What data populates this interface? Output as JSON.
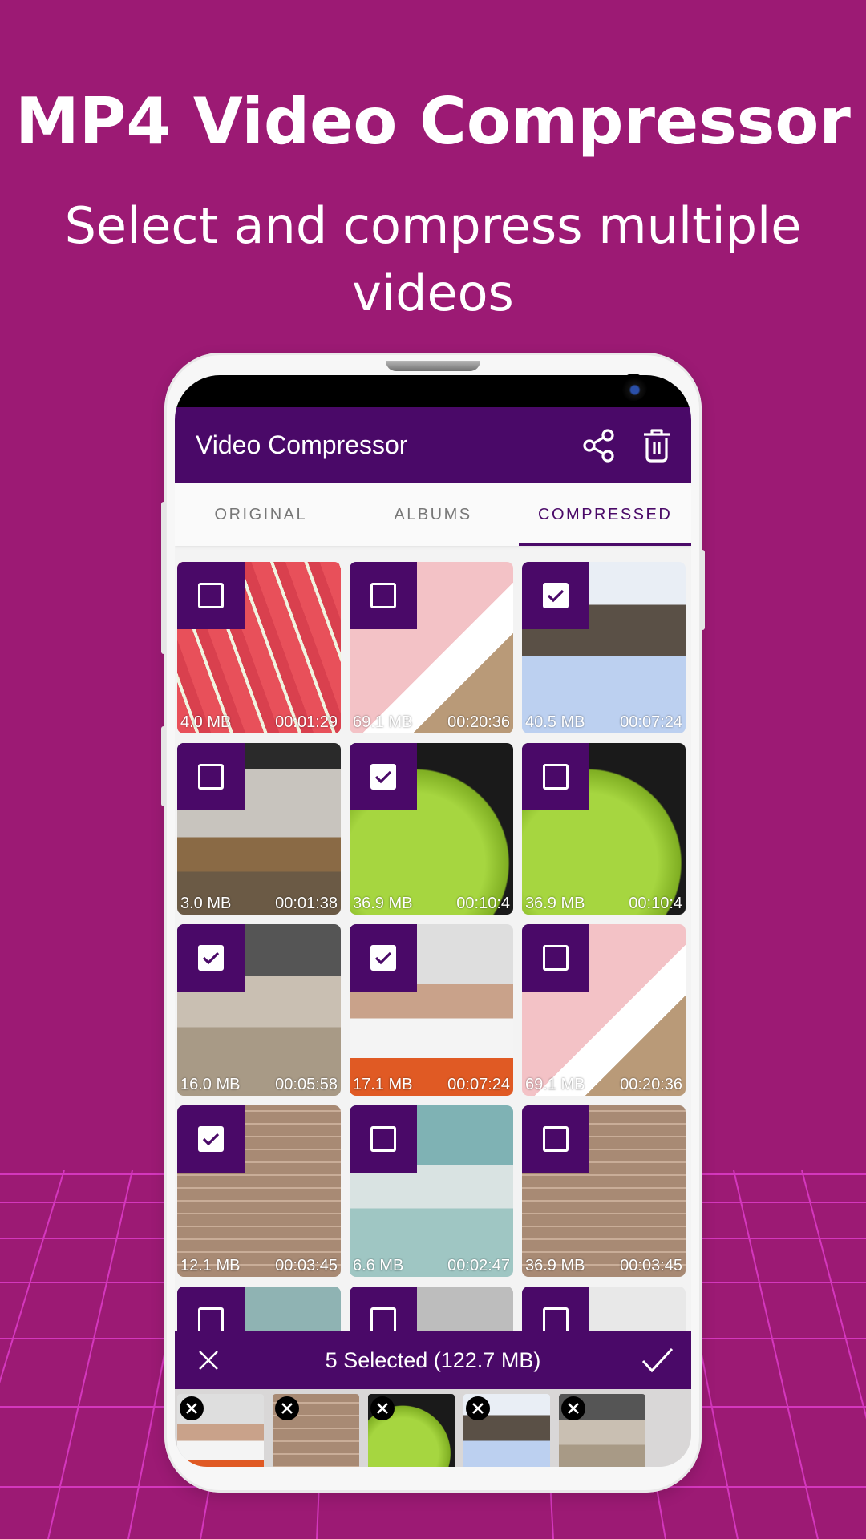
{
  "promo": {
    "headline": "MP4 Video Compressor",
    "subheadline": "Select and compress multiple videos"
  },
  "app": {
    "title": "Video Compressor",
    "actions": [
      {
        "icon": "share-icon",
        "label": "Share"
      },
      {
        "icon": "trash-icon",
        "label": "Delete"
      }
    ],
    "accent_color": "#4a0968",
    "background_color": "#9c1a74"
  },
  "tabs": [
    {
      "label": "ORIGINAL",
      "active": false
    },
    {
      "label": "ALBUMS",
      "active": false
    },
    {
      "label": "COMPRESSED",
      "active": true
    }
  ],
  "videos": [
    {
      "size": "4.0 MB",
      "duration": "00:01:29",
      "selected": false,
      "thumb": "watermelon-slices"
    },
    {
      "size": "69.1 MB",
      "duration": "00:20:36",
      "selected": false,
      "thumb": "baby"
    },
    {
      "size": "40.5 MB",
      "duration": "00:07:24",
      "selected": true,
      "thumb": "frozen-waterfall"
    },
    {
      "size": "3.0 MB",
      "duration": "00:01:38",
      "selected": false,
      "thumb": "child-room"
    },
    {
      "size": "36.9 MB",
      "duration": "00:10:4",
      "selected": true,
      "thumb": "green-melon"
    },
    {
      "size": "36.9 MB",
      "duration": "00:10:4",
      "selected": false,
      "thumb": "green-melon"
    },
    {
      "size": "16.0 MB",
      "duration": "00:05:58",
      "selected": true,
      "thumb": "living-room-dog"
    },
    {
      "size": "17.1 MB",
      "duration": "00:07:24",
      "selected": true,
      "thumb": "woman-talking"
    },
    {
      "size": "69.1 MB",
      "duration": "00:20:36",
      "selected": false,
      "thumb": "baby"
    },
    {
      "size": "12.1 MB",
      "duration": "00:03:45",
      "selected": true,
      "thumb": "boy-brick-wall"
    },
    {
      "size": "6.6 MB",
      "duration": "00:02:47",
      "selected": false,
      "thumb": "group-people"
    },
    {
      "size": "36.9 MB",
      "duration": "00:03:45",
      "selected": false,
      "thumb": "boy-brick-wall"
    }
  ],
  "selection": {
    "summary": "5 Selected (122.7 MB)",
    "count": 5,
    "total_size": "122.7 MB",
    "items": [
      {
        "thumb": "woman-talking"
      },
      {
        "thumb": "boy-brick-wall"
      },
      {
        "thumb": "green-melon"
      },
      {
        "thumb": "frozen-waterfall"
      },
      {
        "thumb": "living-room-dog"
      }
    ]
  }
}
